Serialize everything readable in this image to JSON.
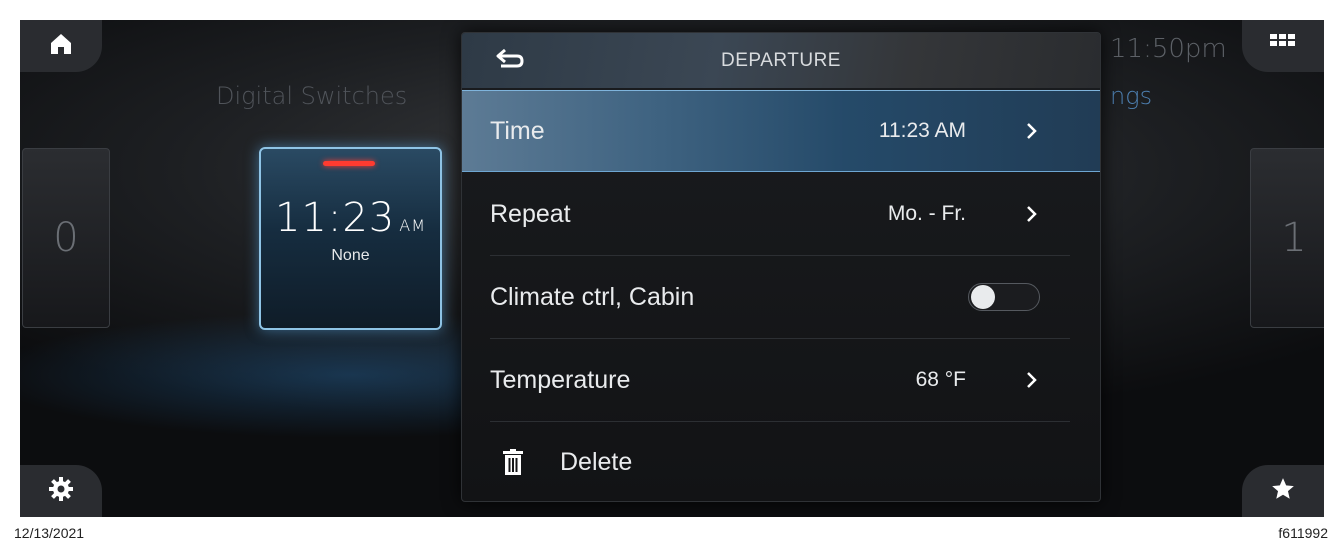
{
  "screen": {
    "background_title_left": "Digital Switches",
    "background_title_right": "ngs",
    "clock": "11:50pm",
    "left_card_text": "0",
    "right_card_text": "1"
  },
  "alarm_card": {
    "time": "11:23",
    "ampm": "AM",
    "repeat": "None"
  },
  "panel": {
    "title": "DEPARTURE",
    "rows": [
      {
        "label": "Time",
        "value": "11:23 AM",
        "selected": true
      },
      {
        "label": "Repeat",
        "value": "Mo. - Fr."
      },
      {
        "label": "Climate ctrl, Cabin",
        "toggle": false
      },
      {
        "label": "Temperature",
        "value": "68 °F"
      },
      {
        "label": "Delete"
      }
    ]
  },
  "footer": {
    "date": "12/13/2021",
    "figure_id": "f611992"
  },
  "colors": {
    "accent": "#3f6381",
    "alarm_indicator": "#ff3b30",
    "card_border": "#8fc4e6"
  },
  "icons": {
    "home": "home-icon",
    "grid": "grid-icon",
    "settings": "gear-icon",
    "favorite": "star-icon",
    "back": "back-arrow-icon",
    "chevron": "chevron-right-icon",
    "delete": "trash-icon"
  }
}
